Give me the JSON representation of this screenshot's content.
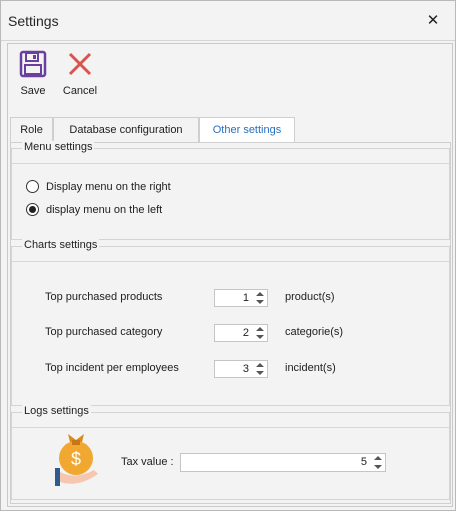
{
  "window": {
    "title": "Settings",
    "close_glyph": "✕"
  },
  "toolbar": {
    "save_label": "Save",
    "save_icon": "floppy-disk-icon",
    "cancel_label": "Cancel",
    "cancel_icon": "close-x-icon"
  },
  "tabs": [
    {
      "label": "Role",
      "active": false
    },
    {
      "label": "Database configuration",
      "active": false
    },
    {
      "label": "Other settings",
      "active": true
    }
  ],
  "menu_settings": {
    "title": "Menu settings",
    "options": [
      {
        "label": "Display menu on the right",
        "selected": false
      },
      {
        "label": "display menu on the left",
        "selected": true
      }
    ]
  },
  "charts_settings": {
    "title": "Charts settings",
    "rows": [
      {
        "label": "Top purchased products",
        "value": "1",
        "unit": "product(s)"
      },
      {
        "label": "Top purchased category",
        "value": "2",
        "unit": "categorie(s)"
      },
      {
        "label": "Top incident per employees",
        "value": "3",
        "unit": "incident(s)"
      }
    ]
  },
  "logs_settings": {
    "title": "Logs settings",
    "icon": "money-bag-hand-icon",
    "tax_label": "Tax value :",
    "tax_value": "5"
  },
  "colors": {
    "accent_tab": "#2a6fbe",
    "save_icon": "#6b3fa0",
    "cancel_icon": "#d9534f",
    "money_bag": "#f0a830"
  }
}
